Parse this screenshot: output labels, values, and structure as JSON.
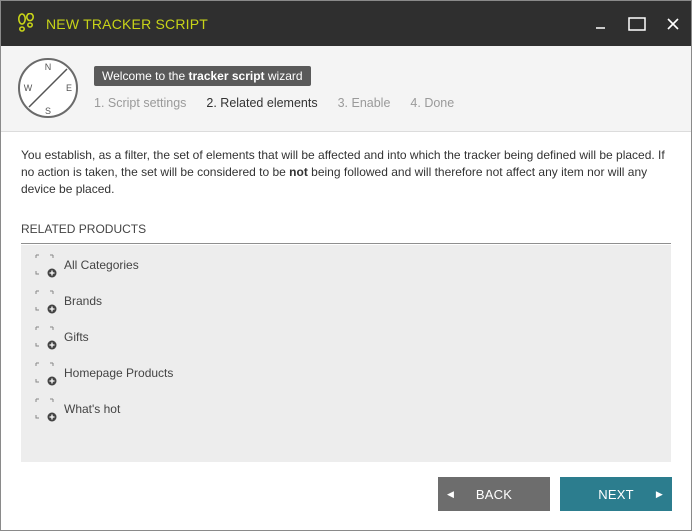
{
  "window": {
    "title": "NEW TRACKER SCRIPT",
    "controls": [
      "minimize",
      "maximize",
      "close"
    ],
    "colors": {
      "titlebar_bg": "#2f2f2f",
      "title_text": "#c8d418"
    }
  },
  "wizard": {
    "welcome_prefix": "Welcome to the ",
    "welcome_bold": "tracker script",
    "welcome_suffix": " wizard",
    "compass_letters": {
      "n": "N",
      "e": "E",
      "s": "S",
      "w": "W"
    },
    "steps": [
      {
        "label": "1. Script settings",
        "active": false
      },
      {
        "label": "2. Related elements",
        "active": true
      },
      {
        "label": "3. Enable",
        "active": false
      },
      {
        "label": "4. Done",
        "active": false
      }
    ]
  },
  "description": {
    "part1": "You establish, as a filter, the set of elements that will be affected and into which the tracker being defined will be placed. If no action is taken, the set will be considered to be ",
    "bold": "not",
    "part2": " being followed and will therefore not affect any item nor will any device be placed."
  },
  "related_products": {
    "title": "RELATED PRODUCTS",
    "items": [
      {
        "label": "All Categories"
      },
      {
        "label": "Brands"
      },
      {
        "label": "Gifts"
      },
      {
        "label": "Homepage Products"
      },
      {
        "label": "What's hot"
      }
    ]
  },
  "footer": {
    "back_label": "BACK",
    "next_label": "NEXT",
    "colors": {
      "back_bg": "#6d6d6d",
      "next_bg": "#2c7d8e"
    }
  }
}
